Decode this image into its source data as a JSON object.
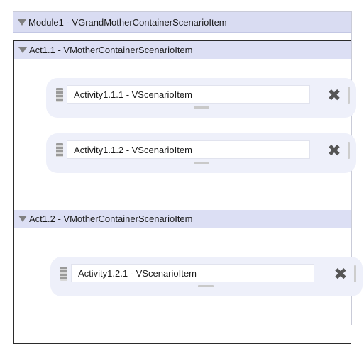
{
  "module": {
    "title": "Module1 - VGrandMotherContainerScenarioItem",
    "acts": [
      {
        "title": "Act1.1 - VMotherContainerScenarioItem",
        "activities": [
          {
            "label": "Activity1.1.1 - VScenarioItem"
          },
          {
            "label": "Activity1.1.2 - VScenarioItem"
          }
        ]
      },
      {
        "title": "Act1.2 - VMotherContainerScenarioItem",
        "activities": [
          {
            "label": "Activity1.2.1 - VScenarioItem"
          }
        ]
      }
    ]
  },
  "icons": {
    "collapse": "triangle-down-icon",
    "drag": "drag-handle-icon",
    "delete": "close-icon",
    "resize": "resize-bar-icon"
  },
  "colors": {
    "module_header_bg": "#d9dcf2",
    "act_header_bg": "#dcdff4",
    "activity_bg": "#eef0fa",
    "act_border": "#2b2b2b"
  }
}
